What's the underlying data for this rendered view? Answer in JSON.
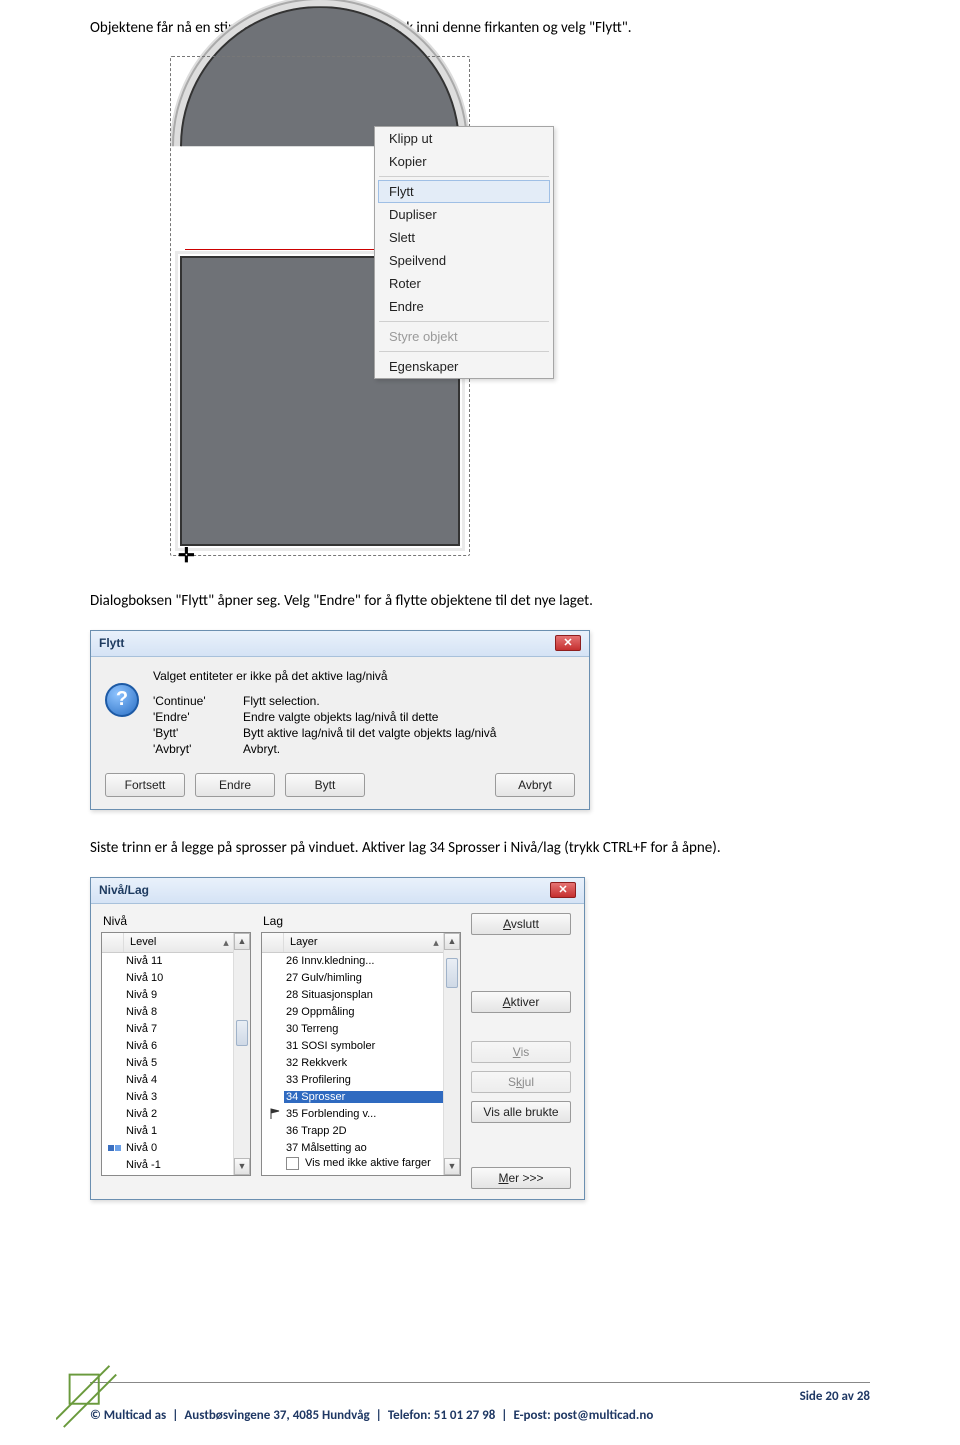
{
  "text": {
    "p1": "Objektene får nå en stiplet linje rundt seg. Høyreklikk inni denne firkanten og velg \"Flytt\".",
    "p2": "Dialogboksen \"Flytt\" åpner seg. Velg \"Endre\" for å flytte objektene til det nye laget.",
    "p3": "Siste trinn er å legge på sprosser på vinduet. Aktiver lag 34 Sprosser i Nivå/lag (trykk CTRL+F for å åpne)."
  },
  "context_menu": {
    "items": [
      {
        "label": "Klipp ut",
        "enabled": true
      },
      {
        "label": "Kopier",
        "enabled": true
      },
      {
        "sep": true
      },
      {
        "label": "Flytt",
        "enabled": true,
        "highlight": true
      },
      {
        "label": "Dupliser",
        "enabled": true
      },
      {
        "label": "Slett",
        "enabled": true
      },
      {
        "label": "Speilvend",
        "enabled": true
      },
      {
        "label": "Roter",
        "enabled": true
      },
      {
        "label": "Endre",
        "enabled": true
      },
      {
        "sep": true
      },
      {
        "label": "Styre objekt",
        "enabled": false
      },
      {
        "sep": true
      },
      {
        "label": "Egenskaper",
        "enabled": true
      }
    ]
  },
  "flytt_dialog": {
    "title": "Flytt",
    "message": "Valget entiteter er ikke på det aktive lag/nivå",
    "defs": [
      {
        "key": "'Continue'",
        "val": "Flytt selection."
      },
      {
        "key": "'Endre'",
        "val": "Endre valgte objekts lag/nivå til dette"
      },
      {
        "key": "'Bytt'",
        "val": "Bytt aktive lag/nivå til det valgte objekts lag/nivå"
      },
      {
        "key": "'Avbryt'",
        "val": "Avbryt."
      }
    ],
    "buttons": {
      "fortsett": "Fortsett",
      "endre": "Endre",
      "bytt": "Bytt",
      "avbryt": "Avbryt"
    }
  },
  "nivalag": {
    "title": "Nivå/Lag",
    "niva_label": "Nivå",
    "lag_label": "Lag",
    "level_header": "Level",
    "layer_header": "Layer",
    "niva_items": [
      "Nivå 11",
      "Nivå 10",
      "Nivå 9",
      "Nivå 8",
      "Nivå 7",
      "Nivå 6",
      "Nivå 5",
      "Nivå 4",
      "Nivå 3",
      "Nivå 2",
      "Nivå 1",
      "Nivå 0",
      "Nivå -1"
    ],
    "lag_items": [
      {
        "t": "26 Innv.kledning..."
      },
      {
        "t": "27 Gulv/himling"
      },
      {
        "t": "28 Situasjonsplan"
      },
      {
        "t": "29 Oppmåling"
      },
      {
        "t": "30 Terreng"
      },
      {
        "t": "31 SOSI symboler"
      },
      {
        "t": "32 Rekkverk"
      },
      {
        "t": "33 Profilering"
      },
      {
        "t": "34 Sprosser",
        "selected": true
      },
      {
        "t": "35 Forblending v...",
        "flag": true
      },
      {
        "t": "36 Trapp 2D"
      },
      {
        "t": "37 Målsetting ao"
      }
    ],
    "buttons": {
      "avslutt": {
        "t": "Avslutt",
        "u": "A"
      },
      "aktiver": {
        "t": "Aktiver",
        "u": "A"
      },
      "vis": {
        "t": "Vis",
        "u": "V",
        "disabled": true
      },
      "skjul": {
        "t": "Skjul",
        "u": "k",
        "disabled": true
      },
      "vis_alle": "Vis alle brukte",
      "mer": {
        "t": "Mer >>>",
        "u": "M"
      }
    },
    "checkbox_label": "Vis med ikke aktive farger"
  },
  "footer": {
    "page_label": "Side 20 av 28",
    "company": "© Multicad as",
    "address": "Austbøsvingene 37, 4085 Hundvåg",
    "phone_label": "Telefon: 51 01 27 98",
    "email_label": "E-post: post@multicad.no"
  }
}
